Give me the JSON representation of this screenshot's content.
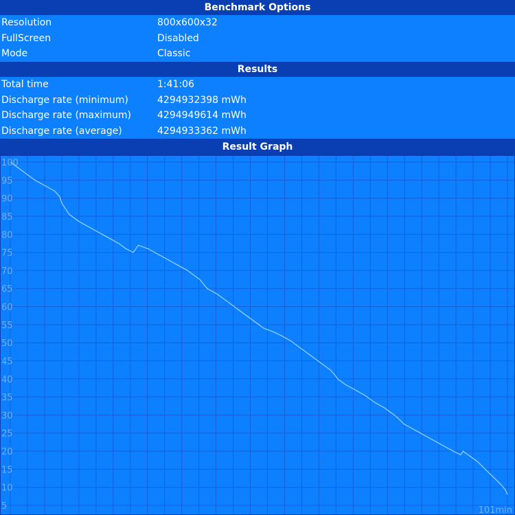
{
  "benchmark_options": {
    "title": "Benchmark Options",
    "rows": [
      {
        "label": "Resolution",
        "value": "800x600x32"
      },
      {
        "label": "FullScreen",
        "value": "Disabled"
      },
      {
        "label": "Mode",
        "value": "Classic"
      }
    ]
  },
  "results": {
    "title": "Results",
    "rows": [
      {
        "label": "Total time",
        "value": "1:41:06"
      },
      {
        "label": "Discharge rate (minimum)",
        "value": "4294932398 mWh"
      },
      {
        "label": "Discharge rate (maximum)",
        "value": "4294949614 mWh"
      },
      {
        "label": "Discharge rate (average)",
        "value": "4294933362 mWh"
      }
    ]
  },
  "result_graph": {
    "title": "Result Graph",
    "x_max_label": "101min"
  },
  "colors": {
    "header_bg": "#0a3fb4",
    "row_bg": "#0c80ff",
    "graph_bg": "#0c80ff",
    "grid": "#1560d8",
    "line": "#8fd0ff",
    "axis_text": "#6fb0ff"
  },
  "chart_data": {
    "type": "line",
    "title": "Result Graph",
    "xlabel": "",
    "ylabel": "",
    "xlim": [
      0,
      101
    ],
    "ylim": [
      5,
      100
    ],
    "y_ticks": [
      100,
      95,
      90,
      85,
      80,
      75,
      70,
      65,
      60,
      55,
      50,
      45,
      40,
      35,
      30,
      25,
      20,
      15,
      10,
      5
    ],
    "x_tick_label": "101min",
    "grid": true,
    "series": [
      {
        "x": [
          0,
          1,
          3,
          5,
          7,
          9,
          10,
          10.5,
          12,
          14,
          16,
          18,
          20,
          22,
          23.5,
          25,
          26,
          28,
          30,
          32,
          34,
          36,
          37.5,
          38.5,
          40,
          42,
          44,
          46,
          48,
          50,
          51.5,
          53.5,
          55,
          57,
          59,
          61,
          63,
          65,
          66,
          66.5,
          68,
          70,
          72,
          74,
          76,
          77,
          78,
          78.5,
          80,
          82,
          84,
          86,
          88,
          90,
          91.5,
          92,
          93,
          95,
          96.5,
          98,
          99.5,
          100.5,
          101
        ],
        "y": [
          100,
          99,
          97,
          95,
          93.5,
          92,
          90.5,
          88.5,
          85.5,
          83.5,
          82,
          80.5,
          79,
          77.5,
          76,
          75,
          77,
          76,
          74.5,
          73,
          71.5,
          70,
          68.5,
          67.5,
          65,
          63.5,
          61.5,
          59.5,
          57.5,
          55.5,
          54,
          53,
          52,
          50.5,
          48.5,
          46.5,
          44.5,
          42.5,
          41,
          40,
          38.5,
          37,
          35.5,
          33.5,
          32,
          31,
          30,
          29.5,
          27.5,
          26,
          24.5,
          23,
          21.5,
          20,
          19,
          20,
          19,
          17,
          15,
          13,
          11,
          9.5,
          8
        ]
      }
    ]
  }
}
